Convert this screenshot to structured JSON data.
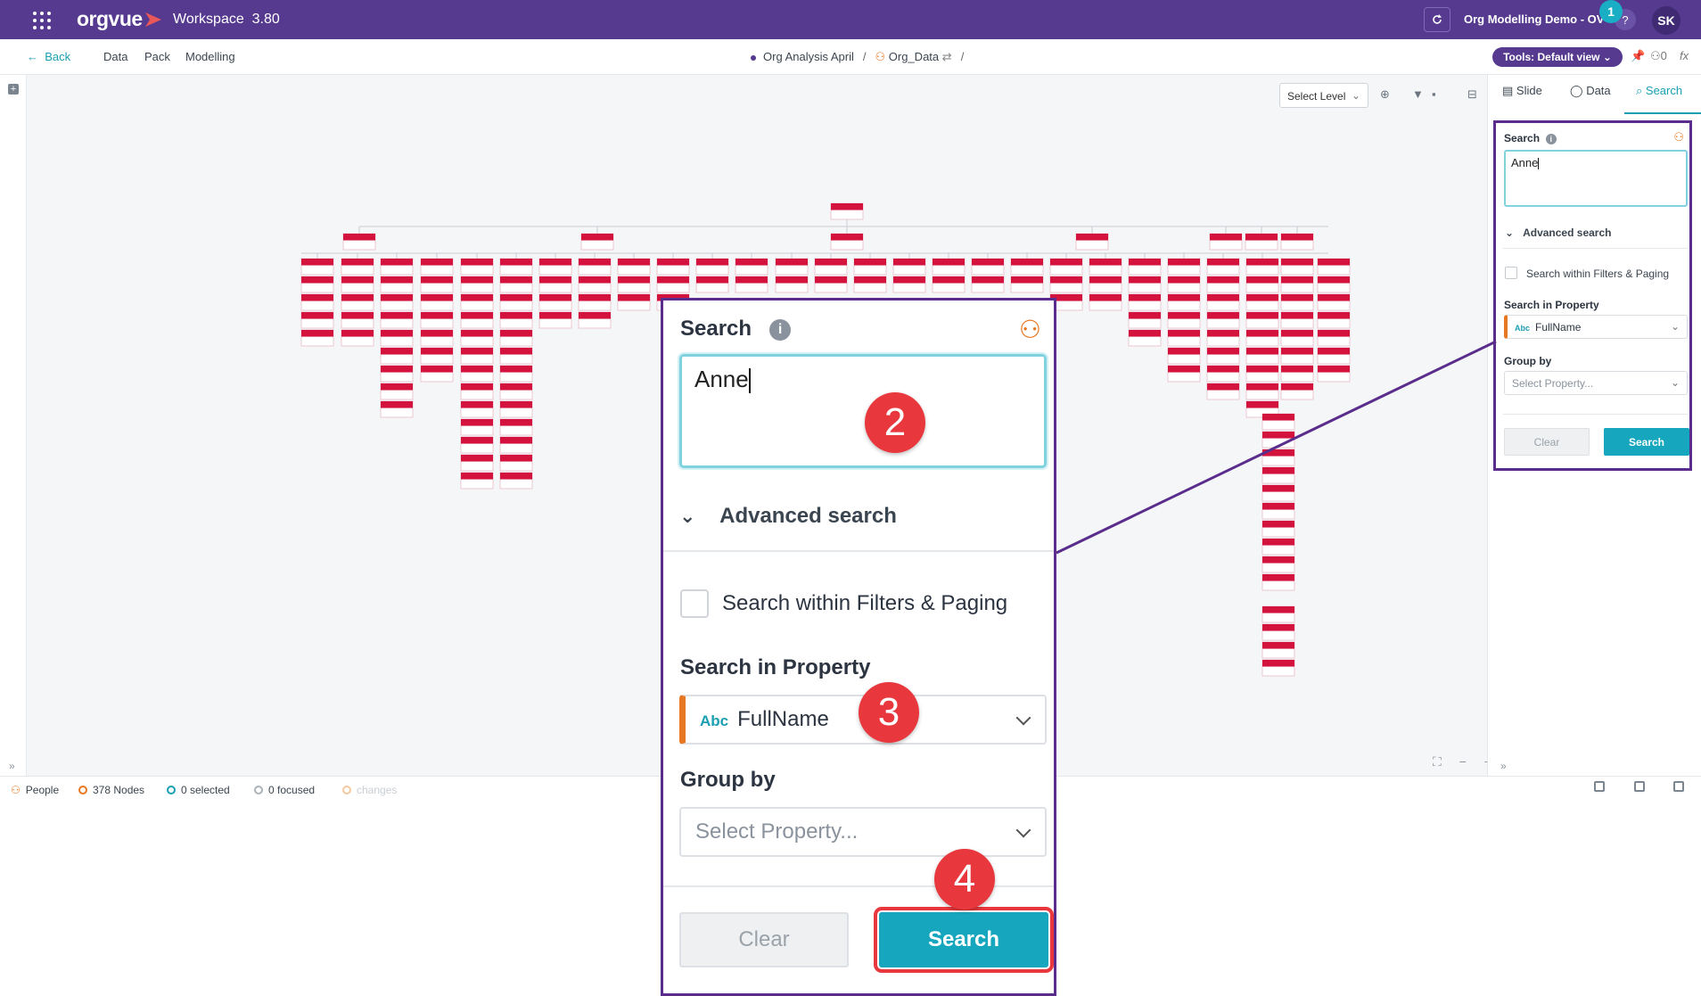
{
  "topbar": {
    "app_name": "orgvue",
    "workspace": "Workspace",
    "version": "3.80",
    "project": "Org Modelling Demo - OV",
    "help": "?",
    "user_initials": "SK",
    "step": "1"
  },
  "nav": {
    "back": "Back",
    "items": [
      "Data",
      "Pack",
      "Modelling"
    ],
    "crumbs": [
      "Org Analysis April",
      "Org_Data"
    ],
    "separator": "/",
    "tools": "Tools: Default view",
    "tools_count": "0"
  },
  "canvas": {
    "select_level": "Select Level",
    "zoom_symbols": "⛶ − +"
  },
  "panel": {
    "tabs": [
      "Slide",
      "Data",
      "Search"
    ],
    "active_tab": "Search",
    "search_label": "Search",
    "search_value": "Anne",
    "advanced": "Advanced search",
    "within_filters": "Search within Filters & Paging",
    "search_in_property": "Search in Property",
    "property_type": "Abc",
    "property_value": "FullName",
    "group_by": "Group by",
    "group_placeholder": "Select Property...",
    "clear": "Clear",
    "search_button": "Search"
  },
  "status": {
    "people": "People",
    "nodes": "378 Nodes",
    "selected": "0 selected",
    "focused": "0 focused",
    "changes": "changes"
  },
  "steps": [
    "2",
    "3",
    "4"
  ],
  "colors": {
    "brand": "#553a8f",
    "accent": "#1a9fb3",
    "callout_border": "#5a2d8c",
    "step_badge": "#e8383d",
    "node": "#d3123e"
  }
}
